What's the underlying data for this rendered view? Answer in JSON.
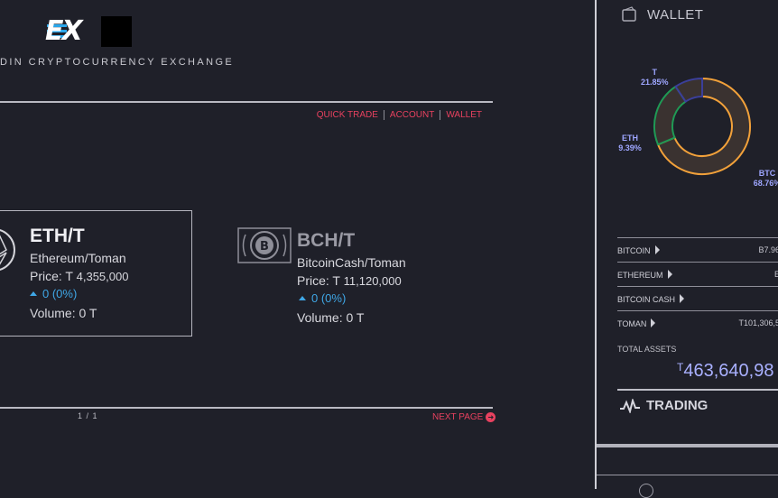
{
  "brand": {
    "logo_text": "EX",
    "tagline": "DIN CRYPTOCURRENCY EXCHANGE"
  },
  "nav": {
    "quick_trade": "QUICK TRADE",
    "account": "ACCOUNT",
    "wallet": "WALLET"
  },
  "markets": [
    {
      "ticker": "ETH/T",
      "name": "Ethereum/Toman",
      "price_label": "Price: T",
      "price": "4,355,000",
      "change": "0 (0%)",
      "volume": "Volume: 0 T",
      "icon": "ethereum-icon",
      "active": true
    },
    {
      "ticker": "BCH/T",
      "name": "BitcoinCash/Toman",
      "price_label": "Price: T",
      "price": "11,120,000",
      "change": "0 (0%)",
      "volume": "Volume: 0 T",
      "icon": "bitcoin-cash-icon",
      "active": false
    }
  ],
  "pagination": {
    "page": "1 / 1",
    "next": "NEXT PAGE"
  },
  "wallet": {
    "title": "WALLET",
    "chart_data": {
      "type": "pie",
      "slices": [
        {
          "label": "BTC",
          "value": 68.76,
          "display": "68.76%",
          "color": "#f2a13a"
        },
        {
          "label": "T",
          "value": 21.85,
          "display": "21.85%",
          "color": "#1f9a55"
        },
        {
          "label": "ETH",
          "value": 9.39,
          "display": "9.39%",
          "color": "#3b3f9a"
        }
      ]
    },
    "assets": [
      {
        "name": "BITCOIN",
        "value": "B7.96"
      },
      {
        "name": "ETHEREUM",
        "value": "E"
      },
      {
        "name": "BITCOIN CASH",
        "value": ""
      },
      {
        "name": "TOMAN",
        "value": "T101,306,5"
      }
    ],
    "total_label": "TOTAL ASSETS",
    "total_currency": "T",
    "total_value": "463,640,98"
  },
  "trading": {
    "title": "TRADING"
  },
  "colors": {
    "accent": "#e8415f",
    "blue": "#3fa7e6",
    "lilac": "#a9b0ff",
    "background": "#1f2029"
  }
}
